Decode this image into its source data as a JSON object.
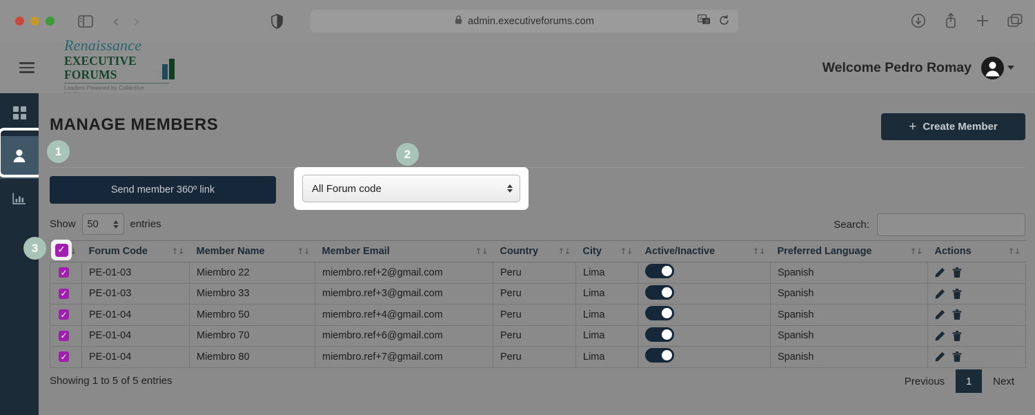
{
  "browser": {
    "url": "admin.executiveforums.com",
    "lock_icon": "lock-icon",
    "traffic_lights": [
      "close",
      "minimize",
      "zoom"
    ],
    "back_glyph": "‹",
    "forward_glyph": "›",
    "toolbar_icons": [
      "sidebar-icon",
      "shield-icon",
      "translate-icon",
      "reload-icon",
      "download-icon",
      "share-icon",
      "new-tab-icon",
      "tab-overview-icon"
    ]
  },
  "header": {
    "menu_icon": "hamburger-icon",
    "logo": {
      "line1": "Renaissance",
      "line2": "EXECUTIVE FORUMS",
      "tagline": "Leaders Powered by Collective Intelligence",
      "colors": {
        "line1": "#2b6470",
        "line2": "#14452b",
        "bar_gray": "#8d8d8d",
        "bar_teal": "#1f4a5e",
        "bar_green": "#123d22"
      }
    },
    "welcome": "Welcome Pedro Romay",
    "avatar_icon": "user-avatar-icon",
    "caret_icon": "chevron-down-icon"
  },
  "sidebar": {
    "items": [
      {
        "name": "dashboard",
        "icon": "grid-icon",
        "active": false
      },
      {
        "name": "members",
        "icon": "person-icon",
        "active": true
      },
      {
        "name": "reports",
        "icon": "bar-chart-icon",
        "active": false
      }
    ],
    "active_bg": "#3f5766",
    "bg": "#1b2b38"
  },
  "main": {
    "title": "MANAGE MEMBERS",
    "create_button": {
      "label": "Create Member",
      "icon": "plus-icon"
    },
    "send_link_button": "Send member 360º link",
    "forum_select": {
      "value": "All Forum code",
      "stepper_icon": "up-down-stepper-icon"
    },
    "show_entries": {
      "prefix": "Show",
      "value": "50",
      "suffix": "entries",
      "stepper_icon": "up-down-stepper-icon"
    },
    "search": {
      "label": "Search:",
      "value": "",
      "placeholder": ""
    }
  },
  "table": {
    "sort_icon": "sort-updown-icon",
    "header_checkbox_checked": true,
    "columns": [
      {
        "key": "checkbox",
        "label": "",
        "sortable": true
      },
      {
        "key": "forum_code",
        "label": "Forum Code",
        "sortable": true
      },
      {
        "key": "member_name",
        "label": "Member Name",
        "sortable": true
      },
      {
        "key": "member_email",
        "label": "Member Email",
        "sortable": true
      },
      {
        "key": "country",
        "label": "Country",
        "sortable": true
      },
      {
        "key": "city",
        "label": "City",
        "sortable": true
      },
      {
        "key": "active",
        "label": "Active/Inactive",
        "sortable": true
      },
      {
        "key": "language",
        "label": "Preferred Language",
        "sortable": true
      },
      {
        "key": "actions",
        "label": "Actions",
        "sortable": true
      }
    ],
    "rows": [
      {
        "checked": true,
        "forum_code": "PE-01-03",
        "member_name": "Miembro 22",
        "member_email": "miembro.ref+2@gmail.com",
        "country": "Peru",
        "city": "Lima",
        "active": true,
        "language": "Spanish",
        "edit_icon": "pencil-icon",
        "delete_icon": "trash-icon"
      },
      {
        "checked": true,
        "forum_code": "PE-01-03",
        "member_name": "Miembro 33",
        "member_email": "miembro.ref+3@gmail.com",
        "country": "Peru",
        "city": "Lima",
        "active": true,
        "language": "Spanish",
        "edit_icon": "pencil-icon",
        "delete_icon": "trash-icon"
      },
      {
        "checked": true,
        "forum_code": "PE-01-04",
        "member_name": "Miembro 50",
        "member_email": "miembro.ref+4@gmail.com",
        "country": "Peru",
        "city": "Lima",
        "active": true,
        "language": "Spanish",
        "edit_icon": "pencil-icon",
        "delete_icon": "trash-icon"
      },
      {
        "checked": true,
        "forum_code": "PE-01-04",
        "member_name": "Miembro 70",
        "member_email": "miembro.ref+6@gmail.com",
        "country": "Peru",
        "city": "Lima",
        "active": true,
        "language": "Spanish",
        "edit_icon": "pencil-icon",
        "delete_icon": "trash-icon"
      },
      {
        "checked": true,
        "forum_code": "PE-01-04",
        "member_name": "Miembro 80",
        "member_email": "miembro.ref+7@gmail.com",
        "country": "Peru",
        "city": "Lima",
        "active": true,
        "language": "Spanish",
        "edit_icon": "pencil-icon",
        "delete_icon": "trash-icon"
      }
    ]
  },
  "footer": {
    "info": "Showing 1 to 5 of 5 entries",
    "previous": "Previous",
    "current_page": "1",
    "next": "Next"
  },
  "annotations": [
    {
      "id": "1",
      "label": "1"
    },
    {
      "id": "2",
      "label": "2"
    },
    {
      "id": "3",
      "label": "3"
    }
  ]
}
